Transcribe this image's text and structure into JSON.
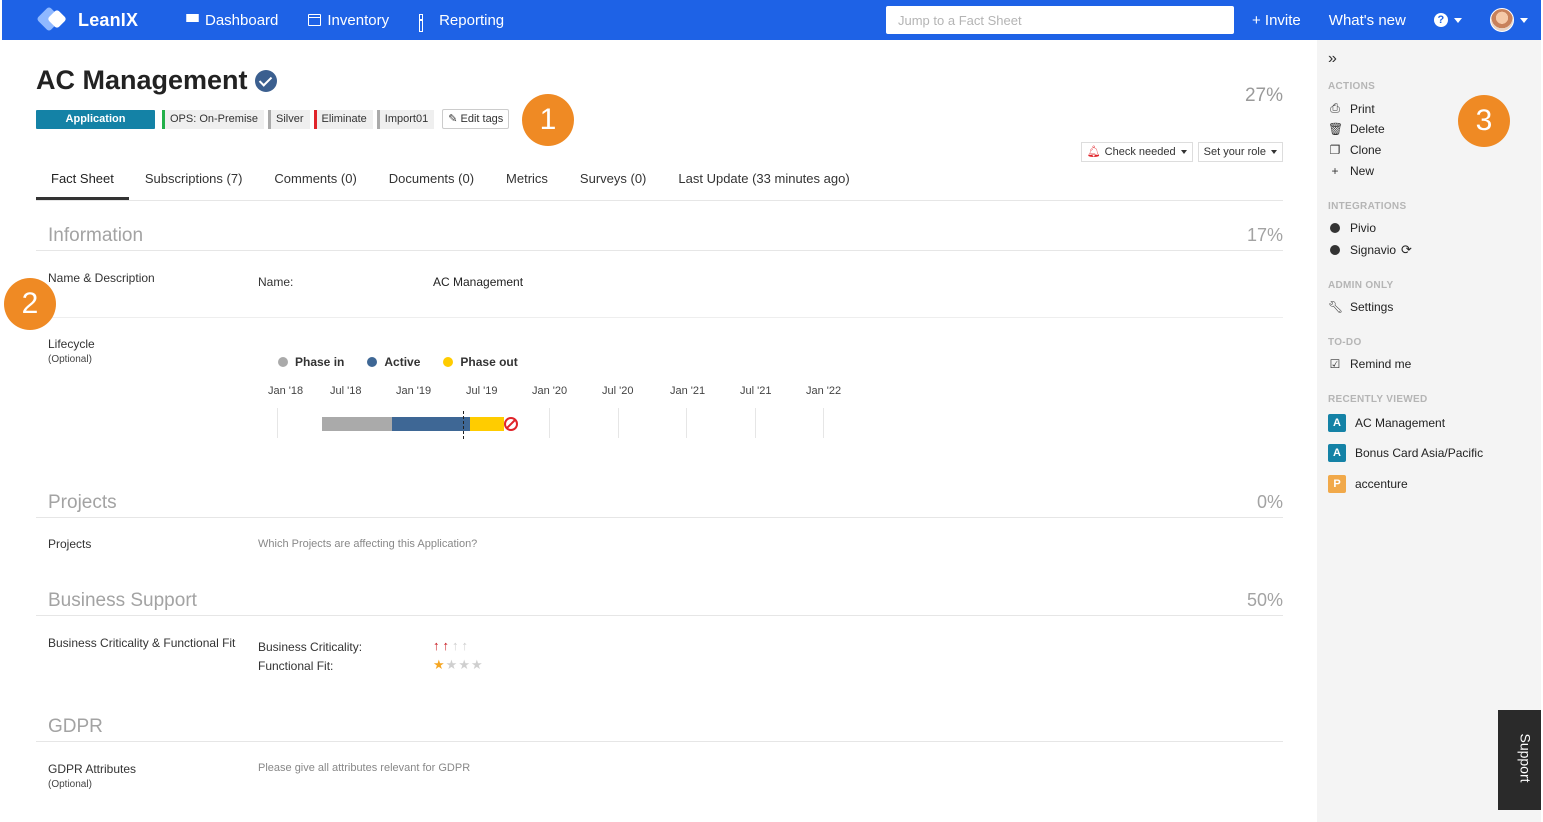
{
  "nav": {
    "brand": "LeanIX",
    "links": [
      {
        "label": "Dashboard",
        "icon": "grid-icon"
      },
      {
        "label": "Inventory",
        "icon": "inventory-icon"
      },
      {
        "label": "Reporting",
        "icon": "bar-chart-icon"
      }
    ],
    "search_placeholder": "Jump to a Fact Sheet",
    "invite": "+ Invite",
    "whats_new": "What's new",
    "help": "?"
  },
  "factsheet": {
    "title": "AC Management",
    "completion": "27%",
    "type_tag": "Application",
    "tags": [
      "OPS: On-Premise",
      "Silver",
      "Eliminate",
      "Import01"
    ],
    "edit_tags": "Edit tags",
    "check_needed": "Check needed",
    "set_role": "Set your role"
  },
  "tabs": [
    "Fact Sheet",
    "Subscriptions (7)",
    "Comments (0)",
    "Documents (0)",
    "Metrics",
    "Surveys (0)",
    "Last Update (33 minutes ago)"
  ],
  "sections": {
    "information": {
      "title": "Information",
      "pct": "17%"
    },
    "name_desc_label": "Name & Description",
    "name_label": "Name:",
    "name_value": "AC Management",
    "lifecycle_label": "Lifecycle",
    "optional": "(Optional)",
    "lifecycle_legend": [
      "Phase in",
      "Active",
      "Phase out"
    ],
    "lifecycle_ticks": [
      "Jan '18",
      "Jul '18",
      "Jan '19",
      "Jul '19",
      "Jan '20",
      "Jul '20",
      "Jan '21",
      "Jul '21",
      "Jan '22"
    ],
    "projects": {
      "title": "Projects",
      "pct": "0%"
    },
    "projects_label": "Projects",
    "projects_hint": "Which Projects are affecting this Application?",
    "business_support": {
      "title": "Business Support",
      "pct": "50%"
    },
    "bs_label": "Business Criticality & Functional Fit",
    "criticality_label": "Business Criticality:",
    "functional_fit_label": "Functional Fit:",
    "criticality_level": 2,
    "criticality_max": 4,
    "functional_fit_level": 1,
    "functional_fit_max": 4,
    "gdpr": {
      "title": "GDPR"
    },
    "gdpr_label": "GDPR Attributes",
    "gdpr_hint": "Please give all attributes relevant for GDPR"
  },
  "sidebar": {
    "actions_head": "ACTIONS",
    "actions": [
      "Print",
      "Delete",
      "Clone",
      "New"
    ],
    "integrations_head": "INTEGRATIONS",
    "integrations": [
      "Pivio",
      "Signavio"
    ],
    "admin_head": "ADMIN ONLY",
    "settings": "Settings",
    "todo_head": "TO-DO",
    "remind": "Remind me",
    "recent_head": "RECENTLY VIEWED",
    "recent": [
      {
        "badge": "A",
        "label": "AC Management",
        "color": "#1482a6"
      },
      {
        "badge": "A",
        "label": "Bonus Card Asia/Pacific",
        "color": "#1482a6"
      },
      {
        "badge": "P",
        "label": "accenture",
        "color": "#f1a94a"
      }
    ],
    "support": "Support"
  },
  "callouts": [
    "1",
    "2",
    "3"
  ],
  "colors": {
    "navbar": "#1e62e6",
    "phase_in": "#aaaaaa",
    "active": "#3e6795",
    "phase_out": "#ffcc00",
    "callout": "#ef8a24"
  }
}
